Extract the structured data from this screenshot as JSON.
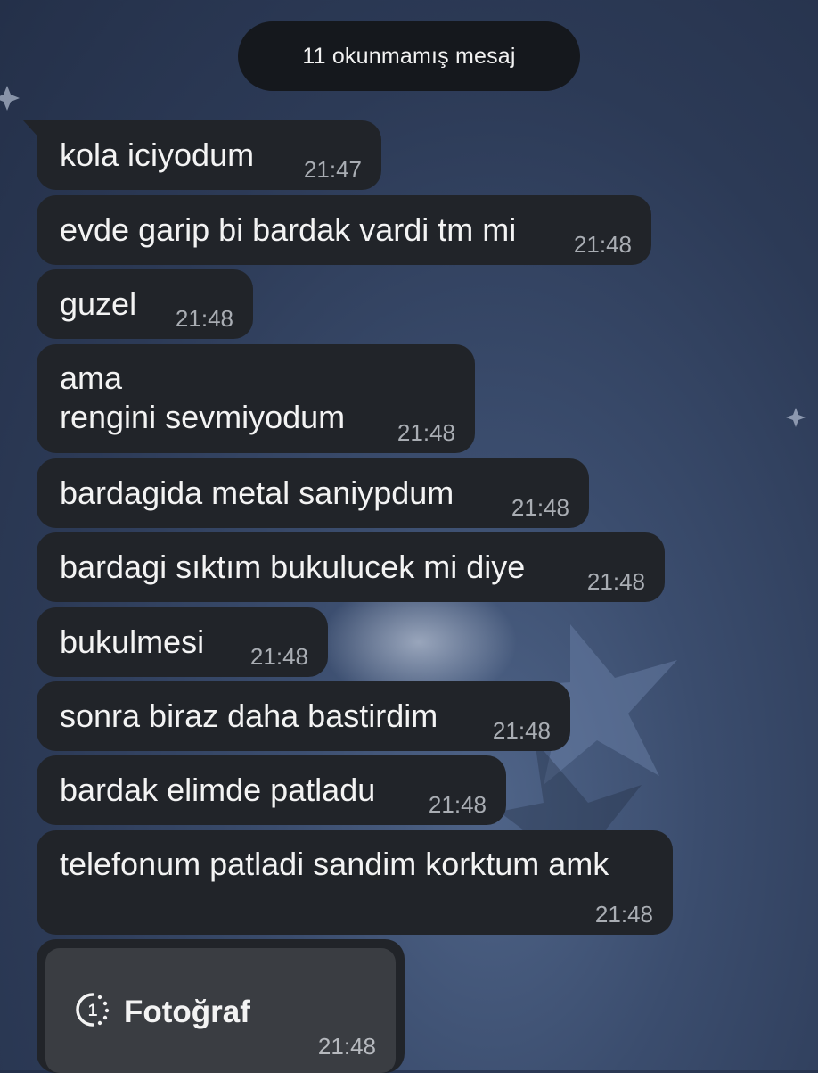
{
  "unread_divider": "11 okunmamış mesaj",
  "messages": [
    {
      "text": "kola iciyodum",
      "time": "21:47"
    },
    {
      "text": "evde garip bi bardak vardi tm mi",
      "time": "21:48"
    },
    {
      "text": "guzel",
      "time": "21:48"
    },
    {
      "text": "ama\nrengini sevmiyodum",
      "time": "21:48"
    },
    {
      "text": "bardagida metal saniypdum",
      "time": "21:48"
    },
    {
      "text": "bardagi sıktım bukulucek mi diye",
      "time": "21:48"
    },
    {
      "text": "bukulmesi",
      "time": "21:48"
    },
    {
      "text": "sonra biraz daha bastirdim",
      "time": "21:48"
    },
    {
      "text": "bardak elimde patladu",
      "time": "21:48"
    },
    {
      "text": "telefonum patladi sandim korktum amk",
      "time": "21:48"
    }
  ],
  "photo_message": {
    "label": "Fotoğraf",
    "time": "21:48",
    "icon": "view-once-icon"
  },
  "colors": {
    "bubble": "#212429",
    "pill": "#15181d",
    "timestamp": "#a9adb3",
    "background": "#2c3a56"
  }
}
